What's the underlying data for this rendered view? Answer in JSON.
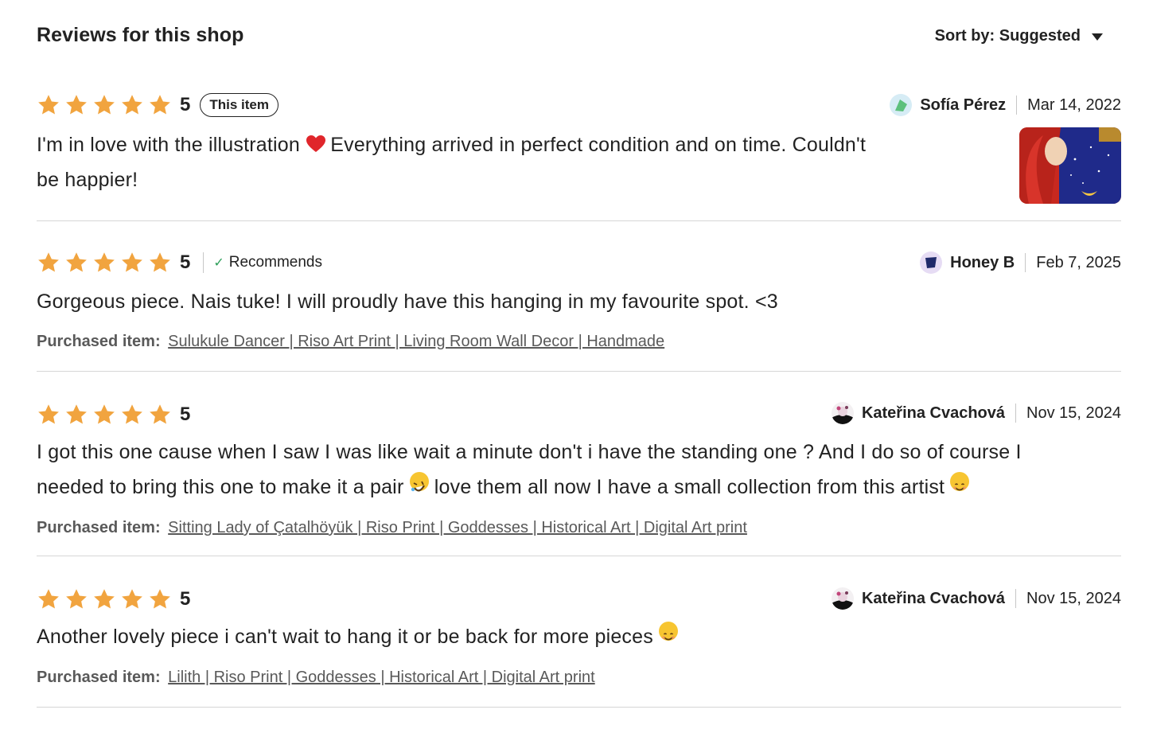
{
  "header": {
    "title": "Reviews for this shop",
    "sort_label": "Sort by: Suggested"
  },
  "colors": {
    "star": "#f1a43f",
    "text": "#222222",
    "muted": "#595959",
    "divider": "#d6d6d6"
  },
  "reviews": [
    {
      "rating": "5",
      "badge": "This item",
      "author": "Sofía Pérez",
      "date": "Mar 14, 2022",
      "text_a": "I'm in love with the illustration ",
      "text_b": " Everything arrived in perfect condition and on time. Couldn't",
      "text_c": "be happier!",
      "emoji": "heart-emoji",
      "avatar": "green-shape-avatar",
      "photo": "review-photo"
    },
    {
      "rating": "5",
      "recommends": "Recommends",
      "author": "Honey B",
      "date": "Feb 7, 2025",
      "text": "Gorgeous piece. Nais tuke! I will proudly have this hanging in my favourite spot. <3",
      "purchased_label": "Purchased item:",
      "purchased_item": "Sulukule Dancer | Riso Art Print | Living Room Wall Decor | Handmade",
      "avatar": "navy-shape-avatar"
    },
    {
      "rating": "5",
      "author": "Kateřina Cvachová",
      "date": "Nov 15, 2024",
      "text_a": "I got this one cause when I saw I was like wait a minute don't i have the standing one ? And I do so of course I",
      "text_b": "needed to bring this one to make it a pair ",
      "text_c": " love them all now I have a small collection from this artist ",
      "purchased_label": "Purchased item:",
      "purchased_item": "Sitting Lady of Çatalhöyük | Riso Print | Goddesses | Historical Art | Digital Art print",
      "avatar": "photo-avatar"
    },
    {
      "rating": "5",
      "author": "Kateřina Cvachová",
      "date": "Nov 15, 2024",
      "text": "Another lovely piece i can't wait to hang it or be back for more pieces ",
      "purchased_label": "Purchased item:",
      "purchased_item": "Lilith | Riso Print | Goddesses | Historical Art | Digital Art print",
      "avatar": "photo-avatar"
    }
  ]
}
